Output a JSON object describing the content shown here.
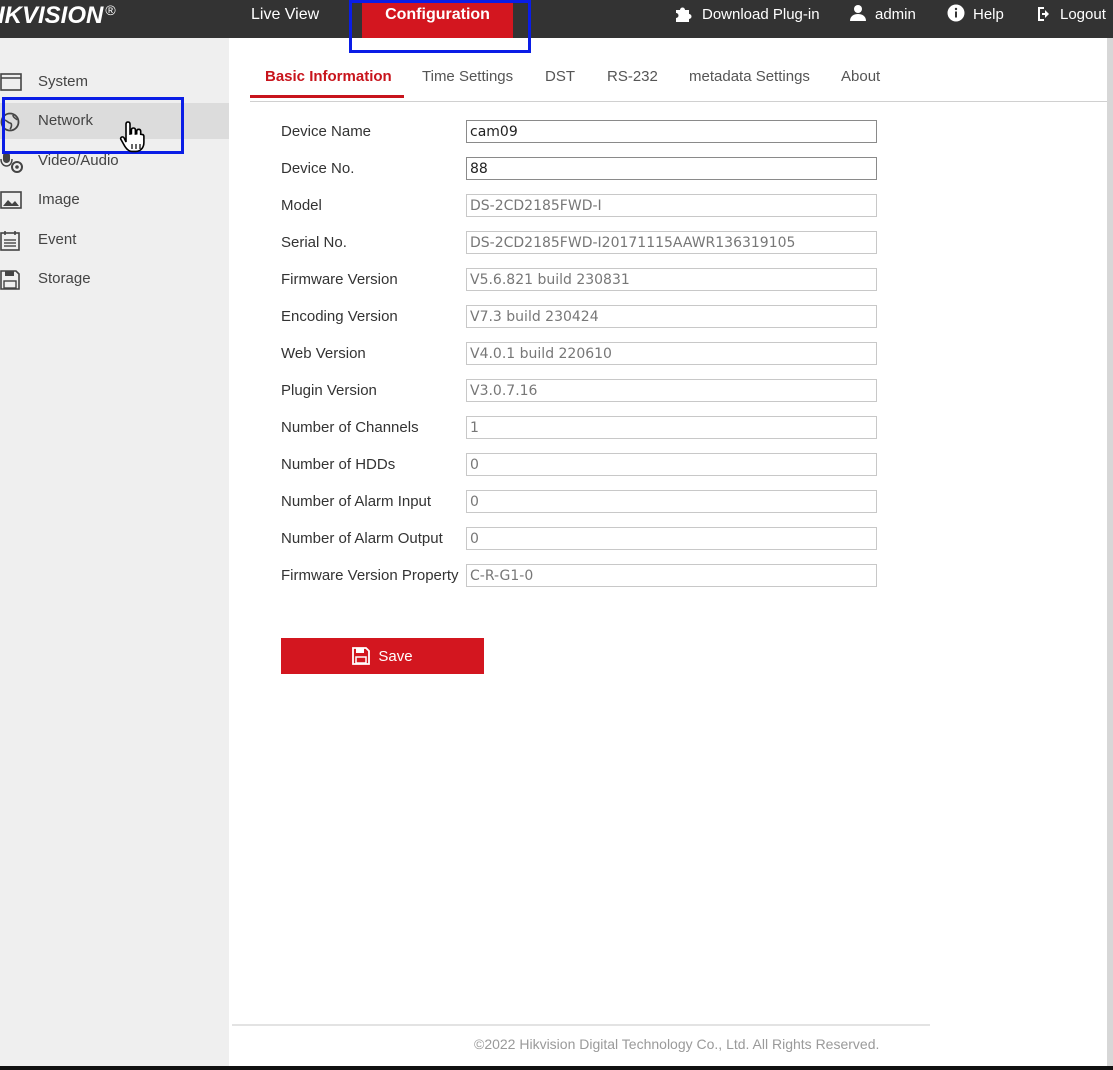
{
  "brand": {
    "logo_text": "IKVISION",
    "logo_reg": "®"
  },
  "topnav": {
    "live_view": "Live View",
    "configuration": "Configuration",
    "download_plugin": "Download Plug-in",
    "admin": "admin",
    "help": "Help",
    "logout": "Logout"
  },
  "sidebar": {
    "items": [
      {
        "label": "System",
        "icon": "system-icon"
      },
      {
        "label": "Network",
        "icon": "network-icon"
      },
      {
        "label": "Video/Audio",
        "icon": "video-audio-icon"
      },
      {
        "label": "Image",
        "icon": "image-icon"
      },
      {
        "label": "Event",
        "icon": "event-icon"
      },
      {
        "label": "Storage",
        "icon": "storage-icon"
      }
    ]
  },
  "tabs": [
    {
      "label": "Basic Information"
    },
    {
      "label": "Time Settings"
    },
    {
      "label": "DST"
    },
    {
      "label": "RS-232"
    },
    {
      "label": "metadata Settings"
    },
    {
      "label": "About"
    }
  ],
  "form": {
    "fields": [
      {
        "label": "Device Name",
        "value": "cam09"
      },
      {
        "label": "Device No.",
        "value": "88"
      },
      {
        "label": "Model",
        "value": "DS-2CD2185FWD-I"
      },
      {
        "label": "Serial No.",
        "value": "DS-2CD2185FWD-I20171115AAWR136319105"
      },
      {
        "label": "Firmware Version",
        "value": "V5.6.821 build 230831"
      },
      {
        "label": "Encoding Version",
        "value": "V7.3 build 230424"
      },
      {
        "label": "Web Version",
        "value": "V4.0.1 build 220610"
      },
      {
        "label": "Plugin Version",
        "value": "V3.0.7.16"
      },
      {
        "label": "Number of Channels",
        "value": "1"
      },
      {
        "label": "Number of HDDs",
        "value": "0"
      },
      {
        "label": "Number of Alarm Input",
        "value": "0"
      },
      {
        "label": "Number of Alarm Output",
        "value": "0"
      },
      {
        "label": "Firmware Version Property",
        "value": "C-R-G1-0"
      }
    ],
    "save_label": "Save"
  },
  "footer": {
    "copyright": "©2022 Hikvision Digital Technology Co., Ltd. All Rights Reserved."
  },
  "colors": {
    "accent": "#d3161f",
    "highlight": "#0a1de6",
    "topbar": "#333333"
  }
}
